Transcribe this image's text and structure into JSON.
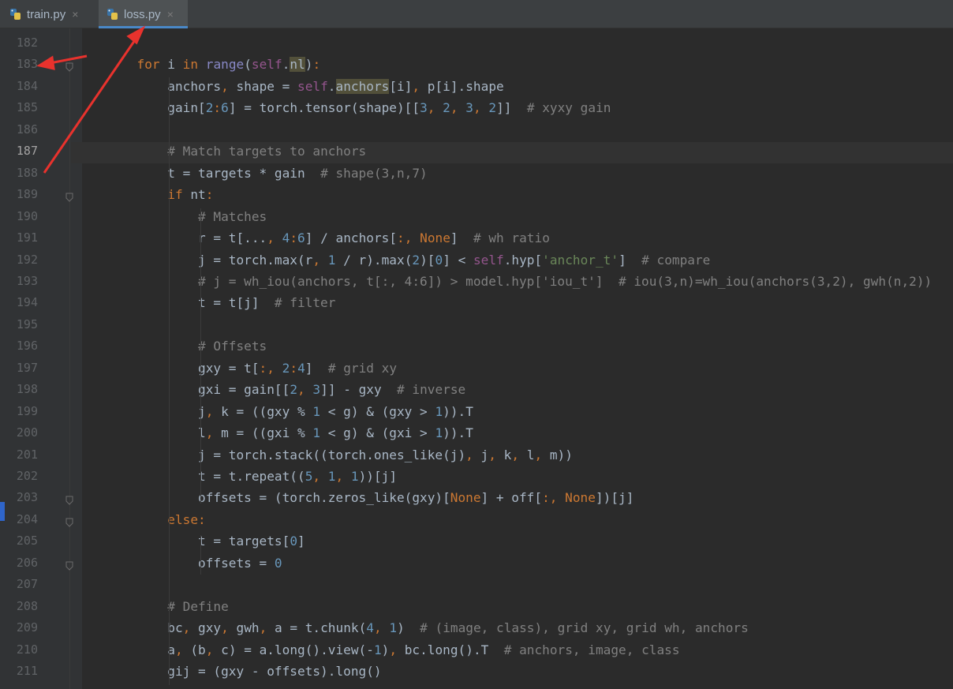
{
  "tabs": [
    {
      "label": "train.py",
      "close": "×",
      "active": false
    },
    {
      "label": "loss.py",
      "close": "×",
      "active": true
    }
  ],
  "icons": {
    "tab_file": "python-file-icon",
    "close": "close-icon",
    "fold": "fold-marker-icon"
  },
  "colors": {
    "keyword": "#cc7832",
    "self": "#94558d",
    "number": "#6897bb",
    "comment": "#808080",
    "string": "#6a8759",
    "builtin": "#8888c6",
    "annotation_arrow": "#e8322d"
  },
  "editor": {
    "current_line": 187,
    "lines": [
      {
        "n": 182,
        "code": ""
      },
      {
        "n": 183,
        "code": "        for i in range(self.nl):"
      },
      {
        "n": 184,
        "code": "            anchors, shape = self.anchors[i], p[i].shape"
      },
      {
        "n": 185,
        "code": "            gain[2:6] = torch.tensor(shape)[[3, 2, 3, 2]]  # xyxy gain"
      },
      {
        "n": 186,
        "code": ""
      },
      {
        "n": 187,
        "code": "            # Match targets to anchors"
      },
      {
        "n": 188,
        "code": "            t = targets * gain  # shape(3,n,7)"
      },
      {
        "n": 189,
        "code": "            if nt:"
      },
      {
        "n": 190,
        "code": "                # Matches"
      },
      {
        "n": 191,
        "code": "                r = t[..., 4:6] / anchors[:, None]  # wh ratio"
      },
      {
        "n": 192,
        "code": "                j = torch.max(r, 1 / r).max(2)[0] < self.hyp['anchor_t']  # compare"
      },
      {
        "n": 193,
        "code": "                # j = wh_iou(anchors, t[:, 4:6]) > model.hyp['iou_t']  # iou(3,n)=wh_iou(anchors(3,2), gwh(n,2))"
      },
      {
        "n": 194,
        "code": "                t = t[j]  # filter"
      },
      {
        "n": 195,
        "code": ""
      },
      {
        "n": 196,
        "code": "                # Offsets"
      },
      {
        "n": 197,
        "code": "                gxy = t[:, 2:4]  # grid xy"
      },
      {
        "n": 198,
        "code": "                gxi = gain[[2, 3]] - gxy  # inverse"
      },
      {
        "n": 199,
        "code": "                j, k = ((gxy % 1 < g) & (gxy > 1)).T"
      },
      {
        "n": 200,
        "code": "                l, m = ((gxi % 1 < g) & (gxi > 1)).T"
      },
      {
        "n": 201,
        "code": "                j = torch.stack((torch.ones_like(j), j, k, l, m))"
      },
      {
        "n": 202,
        "code": "                t = t.repeat((5, 1, 1))[j]"
      },
      {
        "n": 203,
        "code": "                offsets = (torch.zeros_like(gxy)[None] + off[:, None])[j]"
      },
      {
        "n": 204,
        "code": "            else:"
      },
      {
        "n": 205,
        "code": "                t = targets[0]"
      },
      {
        "n": 206,
        "code": "                offsets = 0"
      },
      {
        "n": 207,
        "code": ""
      },
      {
        "n": 208,
        "code": "            # Define"
      },
      {
        "n": 209,
        "code": "            bc, gxy, gwh, a = t.chunk(4, 1)  # (image, class), grid xy, grid wh, anchors"
      },
      {
        "n": 210,
        "code": "            a, (b, c) = a.long().view(-1), bc.long().T  # anchors, image, class"
      },
      {
        "n": 211,
        "code": "            gij = (gxy - offsets).long()"
      }
    ]
  }
}
